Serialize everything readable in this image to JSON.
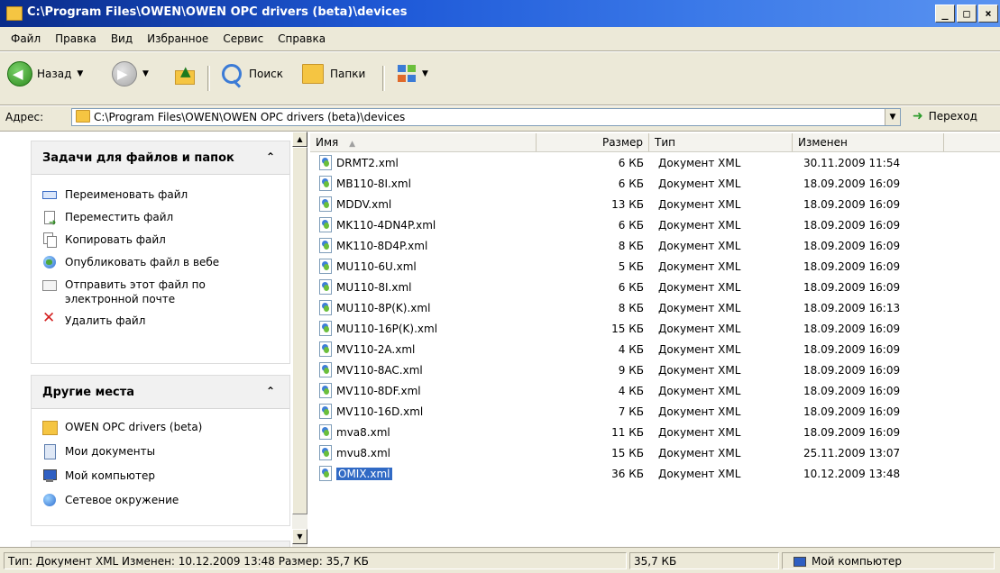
{
  "window": {
    "title": "C:\\Program Files\\OWEN\\OWEN OPC drivers (beta)\\devices",
    "btn_min": "_",
    "btn_max": "□",
    "btn_close": "×"
  },
  "menu": [
    "Файл",
    "Правка",
    "Вид",
    "Избранное",
    "Сервис",
    "Справка"
  ],
  "toolbar": {
    "back_label": "Назад",
    "search_label": "Поиск",
    "folders_label": "Папки"
  },
  "address": {
    "label": "Адрес:",
    "value": "C:\\Program Files\\OWEN\\OWEN OPC drivers (beta)\\devices",
    "go_label": "Переход"
  },
  "tasks_panel": {
    "title": "Задачи для файлов и папок",
    "items": [
      {
        "label": "Переименовать файл",
        "icon": "rename-icon"
      },
      {
        "label": "Переместить файл",
        "icon": "move-icon"
      },
      {
        "label": "Копировать файл",
        "icon": "copy-icon"
      },
      {
        "label": "Опубликовать файл в вебе",
        "icon": "publish-web-icon"
      },
      {
        "label": "Отправить этот файл по электронной почте",
        "icon": "email-icon"
      },
      {
        "label": "Удалить файл",
        "icon": "delete-icon"
      }
    ]
  },
  "places_panel": {
    "title": "Другие места",
    "items": [
      {
        "label": "OWEN OPC drivers (beta)",
        "icon": "folder-icon"
      },
      {
        "label": "Мои документы",
        "icon": "my-documents-icon"
      },
      {
        "label": "Мой компьютер",
        "icon": "my-computer-icon"
      },
      {
        "label": "Сетевое окружение",
        "icon": "network-icon"
      }
    ]
  },
  "columns": {
    "name": "Имя",
    "size": "Размер",
    "type": "Тип",
    "modified": "Изменен"
  },
  "files": [
    {
      "name": "DRMT2.xml",
      "size": "6 КБ",
      "type": "Документ XML",
      "modified": "30.11.2009 11:54"
    },
    {
      "name": "MB110-8I.xml",
      "size": "6 КБ",
      "type": "Документ XML",
      "modified": "18.09.2009 16:09"
    },
    {
      "name": "MDDV.xml",
      "size": "13 КБ",
      "type": "Документ XML",
      "modified": "18.09.2009 16:09"
    },
    {
      "name": "MK110-4DN4P.xml",
      "size": "6 КБ",
      "type": "Документ XML",
      "modified": "18.09.2009 16:09"
    },
    {
      "name": "MK110-8D4P.xml",
      "size": "8 КБ",
      "type": "Документ XML",
      "modified": "18.09.2009 16:09"
    },
    {
      "name": "MU110-6U.xml",
      "size": "5 КБ",
      "type": "Документ XML",
      "modified": "18.09.2009 16:09"
    },
    {
      "name": "MU110-8I.xml",
      "size": "6 КБ",
      "type": "Документ XML",
      "modified": "18.09.2009 16:09"
    },
    {
      "name": "MU110-8P(K).xml",
      "size": "8 КБ",
      "type": "Документ XML",
      "modified": "18.09.2009 16:13"
    },
    {
      "name": "MU110-16P(K).xml",
      "size": "15 КБ",
      "type": "Документ XML",
      "modified": "18.09.2009 16:09"
    },
    {
      "name": "MV110-2A.xml",
      "size": "4 КБ",
      "type": "Документ XML",
      "modified": "18.09.2009 16:09"
    },
    {
      "name": "MV110-8AC.xml",
      "size": "9 КБ",
      "type": "Документ XML",
      "modified": "18.09.2009 16:09"
    },
    {
      "name": "MV110-8DF.xml",
      "size": "4 КБ",
      "type": "Документ XML",
      "modified": "18.09.2009 16:09"
    },
    {
      "name": "MV110-16D.xml",
      "size": "7 КБ",
      "type": "Документ XML",
      "modified": "18.09.2009 16:09"
    },
    {
      "name": "mva8.xml",
      "size": "11 КБ",
      "type": "Документ XML",
      "modified": "18.09.2009 16:09"
    },
    {
      "name": "mvu8.xml",
      "size": "15 КБ",
      "type": "Документ XML",
      "modified": "25.11.2009 13:07"
    },
    {
      "name": "OMIX.xml",
      "size": "36 КБ",
      "type": "Документ XML",
      "modified": "10.12.2009 13:48",
      "selected": true
    }
  ],
  "status": {
    "info": "Тип: Документ XML Изменен: 10.12.2009 13:48 Размер: 35,7 КБ",
    "size": "35,7 КБ",
    "zone": "Мой компьютер"
  }
}
